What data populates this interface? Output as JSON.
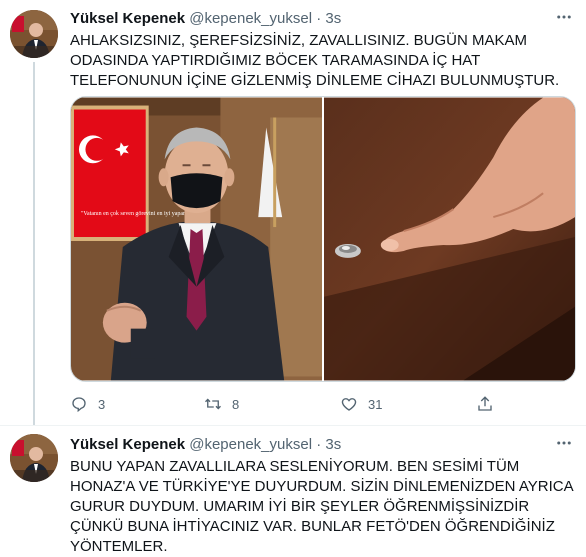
{
  "tweets": [
    {
      "author_name": "Yüksel Kepenek",
      "author_handle": "@kepenek_yuksel",
      "separator": "·",
      "time": "3s",
      "text": "AHLAKSIZSINIZ, ŞEREFSİZSİNİZ, ZAVALLISINIZ. BUGÜN MAKAM ODASINDA YAPTIRDIĞIMIZ BÖCEK TARAMASINDA İÇ HAT TELEFONUNUN İÇİNE GİZLENMİŞ DİNLEME CİHAZI BULUNMUŞTUR.",
      "flag_caption": "\"Vatanın en çok seven görevini en iyi yapandır.\"",
      "reply_count": "3",
      "retweet_count": "8",
      "like_count": "31"
    },
    {
      "author_name": "Yüksel Kepenek",
      "author_handle": "@kepenek_yuksel",
      "separator": "·",
      "time": "3s",
      "text": "BUNU YAPAN ZAVALLILARA SESLENİYORUM. BEN SESİMİ TÜM HONAZ'A VE TÜRKİYE'YE DUYURDUM. SİZİN DİNLEMENİZDEN AYRICA GURUR DUYDUM. UMARIM İYİ BİR ŞEYLER  ÖĞRENMİŞSİNİZDİR ÇÜNKÜ BUNA İHTİYACINIZ VAR. BUNLAR FETÖ'DEN ÖĞRENDİĞİNİZ YÖNTEMLER."
    }
  ],
  "icons": {
    "reply": "reply-icon",
    "retweet": "retweet-icon",
    "like": "heart-icon",
    "share": "share-icon",
    "more": "more-icon"
  },
  "colors": {
    "text": "#0f1419",
    "secondary": "#536471",
    "border": "#cfd9de",
    "flag_red": "#e30a17"
  }
}
